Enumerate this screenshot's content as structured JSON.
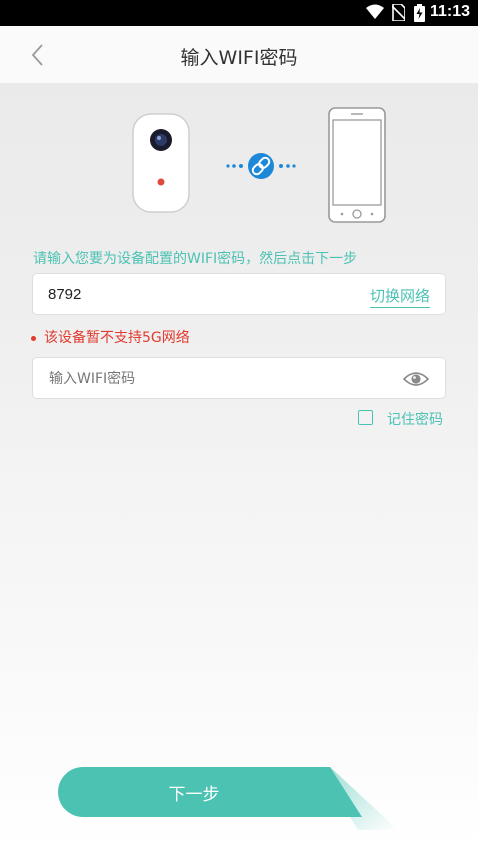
{
  "status_bar": {
    "time": "11:13",
    "icons": [
      "wifi-icon",
      "no-sim-icon",
      "battery-charging-icon"
    ]
  },
  "header": {
    "back_icon": "chevron-left-icon",
    "title": "输入WIFI密码"
  },
  "illustration": {
    "left": "camera-device",
    "middle": "link-icon",
    "right": "smartphone"
  },
  "form": {
    "hint": "请输入您要为设备配置的WIFI密码，然后点击下一步",
    "ssid_value": "8792",
    "switch_network_label": "切换网络",
    "warning": "该设备暂不支持5G网络",
    "password_placeholder": "输入WIFI密码",
    "password_value": "",
    "eye_icon": "eye-icon",
    "remember_label": "记住密码",
    "remember_checked": false
  },
  "next_button": {
    "label": "下一步"
  },
  "colors": {
    "accent": "#4cc2b3",
    "warning": "#e23a2e",
    "link_blue": "#1e88d8"
  }
}
